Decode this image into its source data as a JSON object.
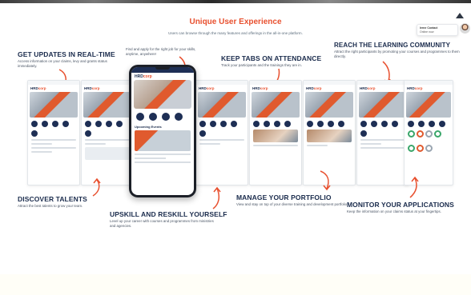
{
  "header": {
    "title": "Unique User Experience",
    "subtitle": "Users can browse through the many features and offerings in the all-in-one platform."
  },
  "chat": {
    "name": "Irene Contact",
    "status": "Online now"
  },
  "features": {
    "updates": {
      "title": "GET UPDATES IN REAL-TIME",
      "desc": "Access information on your claims, levy and grants status immediately."
    },
    "find_jobs": {
      "desc": "Find and apply for the right job for your skills, anytime, anywhere!"
    },
    "attendance": {
      "title": "KEEP TABS ON ATTENDANCE",
      "desc": "Track your participants and the trainings they are in."
    },
    "community": {
      "title": "REACH THE LEARNING COMMUNITY",
      "desc": "Attract the right participants by promoting your courses and programmes to them directly."
    },
    "talents": {
      "title": "DISCOVER TALENTS",
      "desc": "Attract the best talents to grow your team."
    },
    "upskill": {
      "title": "UPSKILL AND RESKILL YOURSELF",
      "desc": "Level up your career with courses and programmes from ministries and agencies."
    },
    "portfolio": {
      "title": "MANAGE YOUR PORTFOLIO",
      "desc": "View and stay on top of your diverse training and development portfolio."
    },
    "applications": {
      "title": "MONITOR YOUR APPLICATIONS",
      "desc": "Keep the information on your claims status at your fingertips."
    }
  },
  "app": {
    "logo_main": "HRD",
    "logo_accent": "corp",
    "section_events": "Upcoming Events"
  },
  "colors": {
    "accent": "#e8502f",
    "navy": "#1a2b4c"
  }
}
